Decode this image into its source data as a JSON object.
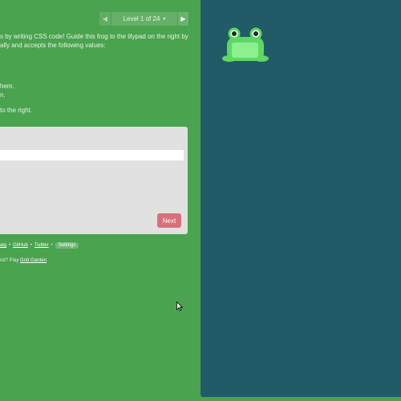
{
  "level_nav": {
    "prev_icon": "◀",
    "next_icon": "▶",
    "label": "Level 1 of 24",
    "caret": "▾"
  },
  "intro": {
    "line1": "s by writing CSS code! Guide this frog to the lilypad on the right by",
    "line2": "ally and accepts the following values:"
  },
  "values_list": {
    "item1": "hem.",
    "item2": "n."
  },
  "task": "to the right.",
  "editor": {
    "input_value": "",
    "input_placeholder": ""
  },
  "next_button_label": "Next",
  "footer": {
    "link1": "aig",
    "sep1": "•",
    "link2": "GitHub",
    "sep2": "•",
    "link3": "Twitter",
    "sep3": "•",
    "settings_label": "Settings"
  },
  "promo": {
    "text": "rid? Play ",
    "link": "Grid Garden"
  },
  "colors": {
    "background": "#4aa34e",
    "pond": "#215b67",
    "next_button": "#d9707a",
    "frog": "#5ed763",
    "frog_belly": "#8cf08f"
  },
  "icons": {
    "prev": "triangle-left",
    "next": "triangle-right",
    "caret": "caret-down",
    "frog": "frog",
    "cursor": "mouse-pointer"
  }
}
